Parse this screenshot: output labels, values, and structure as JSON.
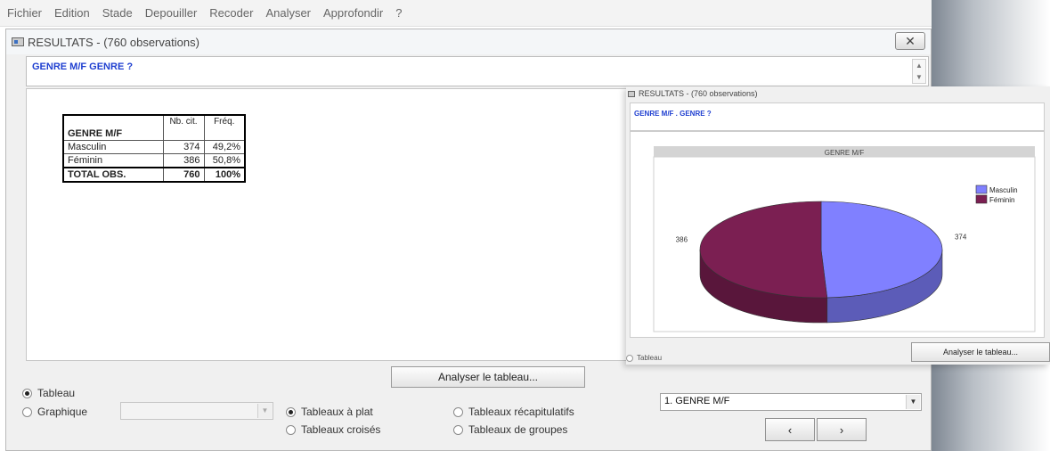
{
  "menu": [
    "Fichier",
    "Edition",
    "Stade",
    "Depouiller",
    "Recoder",
    "Analyser",
    "Approfondir",
    "?"
  ],
  "window": {
    "title": "RESULTATS -  (760 observations)",
    "close_glyph": "✕",
    "header_label": "GENRE M/F   GENRE ?"
  },
  "table": {
    "variable": "GENRE M/F",
    "columns": [
      "Nb. cit.",
      "Fréq."
    ],
    "rows": [
      {
        "label": "Masculin",
        "count": "374",
        "freq": "49,2%"
      },
      {
        "label": "Féminin",
        "count": "386",
        "freq": "50,8%"
      }
    ],
    "total": {
      "label": "TOTAL OBS.",
      "count": "760",
      "freq": "100%"
    }
  },
  "controls": {
    "analyse_button": "Analyser le tableau...",
    "radio_tableau": "Tableau",
    "radio_graphique": "Graphique",
    "graph_combo_value": "",
    "radio_tri_plat": "Tableaux à plat",
    "radio_croises": "Tableaux croisés",
    "radio_recap": "Tableaux récapitulatifs",
    "radio_groupes": "Tableaux de groupes",
    "variable_combo_value": "1. GENRE M/F",
    "prev_label": "‹",
    "next_label": "›"
  },
  "popup": {
    "title": "RESULTATS -  (760 observations)",
    "header_label": "GENRE M/F . GENRE ?",
    "analyse_button": "Analyser le tableau...",
    "radio_tableau": "Tableau"
  },
  "chart_data": {
    "type": "pie",
    "title": "GENRE M/F",
    "categories": [
      "Masculin",
      "Féminin"
    ],
    "values": [
      374,
      386
    ],
    "colors": [
      "#8080ff",
      "#7b1f52"
    ],
    "legend": "right"
  }
}
